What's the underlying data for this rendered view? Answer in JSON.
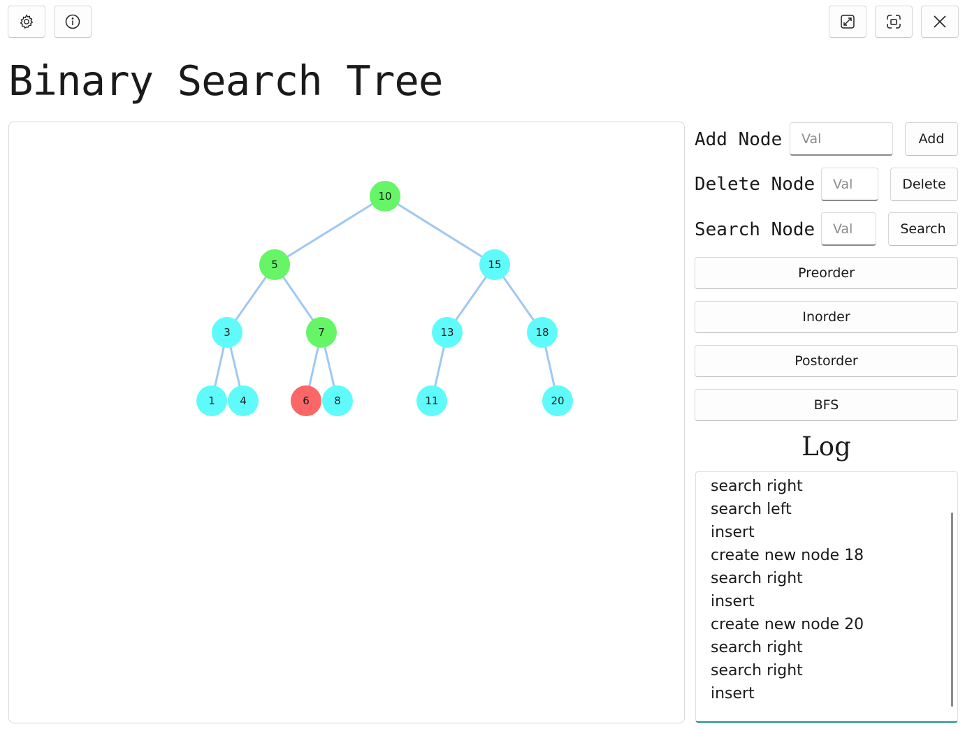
{
  "toolbar": {
    "left_icons": [
      "gear-icon",
      "info-icon"
    ],
    "right_icons": [
      "resize-icon",
      "fullscreen-icon",
      "close-icon"
    ]
  },
  "page_title": "Binary Search Tree",
  "tree": {
    "edge_color": "#a0c8f0",
    "node_colors": {
      "default": "#5ffbfb",
      "path": "#66f566",
      "found": "#fb6666"
    },
    "nodes": [
      {
        "id": "10",
        "label": "10",
        "state": "path"
      },
      {
        "id": "5",
        "label": "5",
        "state": "path"
      },
      {
        "id": "15",
        "label": "15",
        "state": "default"
      },
      {
        "id": "3",
        "label": "3",
        "state": "default"
      },
      {
        "id": "7",
        "label": "7",
        "state": "path"
      },
      {
        "id": "13",
        "label": "13",
        "state": "default"
      },
      {
        "id": "18",
        "label": "18",
        "state": "default"
      },
      {
        "id": "1",
        "label": "1",
        "state": "default"
      },
      {
        "id": "4",
        "label": "4",
        "state": "default"
      },
      {
        "id": "6",
        "label": "6",
        "state": "found"
      },
      {
        "id": "8",
        "label": "8",
        "state": "default"
      },
      {
        "id": "11",
        "label": "11",
        "state": "default"
      },
      {
        "id": "20",
        "label": "20",
        "state": "default"
      }
    ],
    "edges": [
      [
        "10",
        "5"
      ],
      [
        "10",
        "15"
      ],
      [
        "5",
        "3"
      ],
      [
        "5",
        "7"
      ],
      [
        "15",
        "13"
      ],
      [
        "15",
        "18"
      ],
      [
        "3",
        "1"
      ],
      [
        "3",
        "4"
      ],
      [
        "7",
        "6"
      ],
      [
        "7",
        "8"
      ],
      [
        "13",
        "11"
      ],
      [
        "18",
        "20"
      ]
    ]
  },
  "controls": {
    "add": {
      "label": "Add Node",
      "placeholder": "Val",
      "button": "Add"
    },
    "delete": {
      "label": "Delete Node",
      "placeholder": "Val",
      "button": "Delete"
    },
    "search": {
      "label": "Search Node",
      "placeholder": "Val",
      "button": "Search"
    },
    "traversals": [
      "Preorder",
      "Inorder",
      "Postorder",
      "BFS"
    ]
  },
  "log": {
    "title": "Log",
    "entries": [
      "search right",
      "search left",
      "insert",
      "create new node 18",
      "search right",
      "insert",
      "create new node 20",
      "search right",
      "search right",
      "insert"
    ]
  }
}
